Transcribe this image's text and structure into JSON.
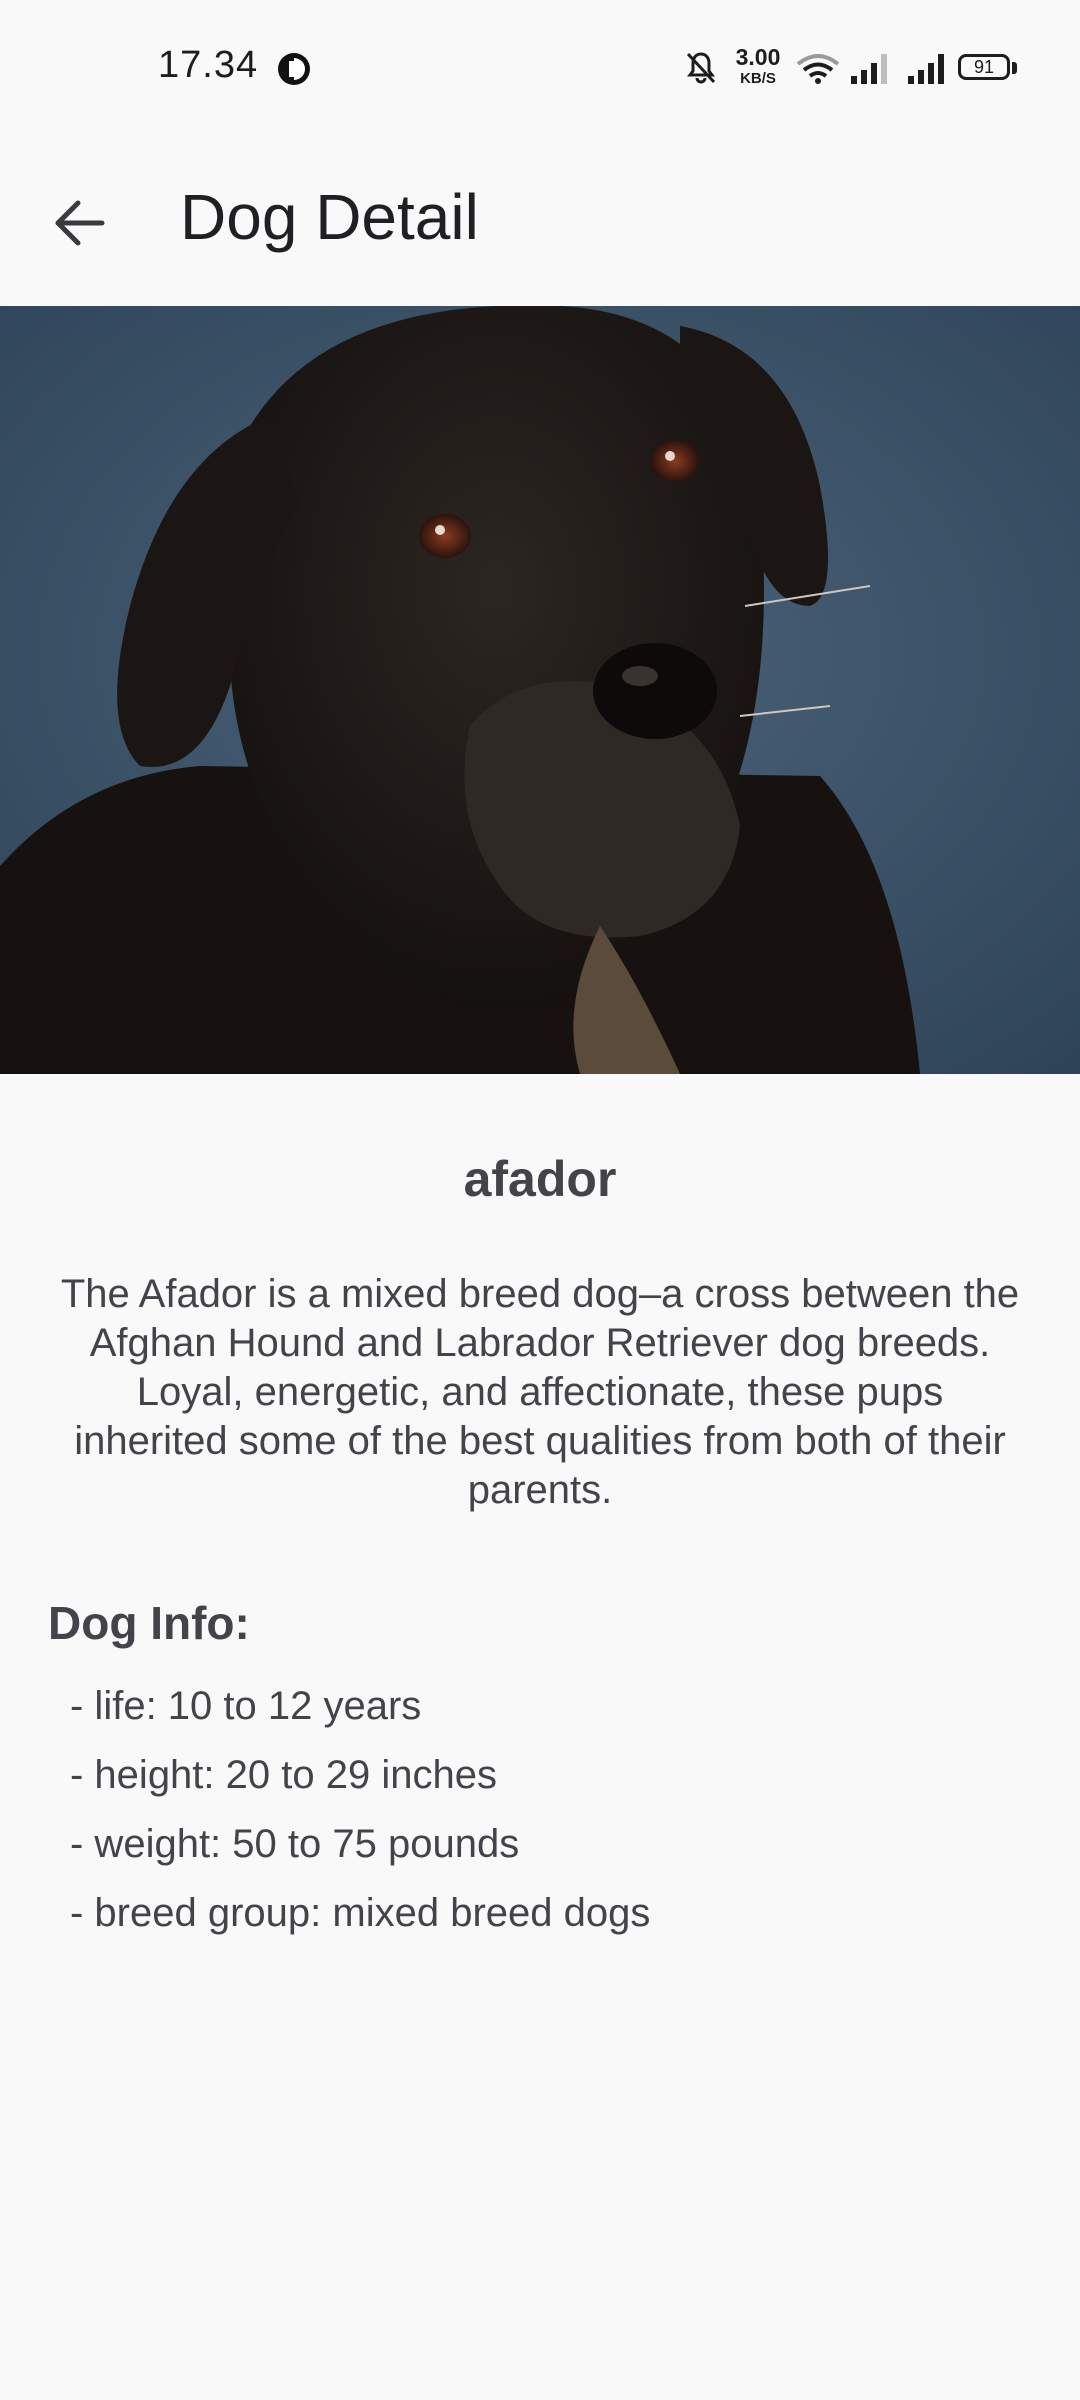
{
  "status_bar": {
    "time": "17.34",
    "net_speed_value": "3.00",
    "net_speed_unit": "KB/S",
    "battery": "91"
  },
  "app_bar": {
    "title": "Dog Detail",
    "back_icon": "arrow-back-icon"
  },
  "hero_image": {
    "subject": "black dog portrait",
    "background_color": "#3c5368"
  },
  "dog": {
    "name": "afador",
    "description": "The Afador is a mixed breed dog–a cross between the Afghan Hound and Labrador Retriever dog breeds. Loyal, energetic, and affectionate, these pups inherited some of the best qualities from both of their parents.",
    "info_heading": "Dog Info:",
    "info": [
      "- life: 10 to 12 years",
      "- height: 20 to 29 inches",
      "- weight: 50 to 75 pounds",
      "- breed group: mixed breed dogs"
    ]
  },
  "colors": {
    "background": "#f9f9f9",
    "text": "#45434a"
  }
}
